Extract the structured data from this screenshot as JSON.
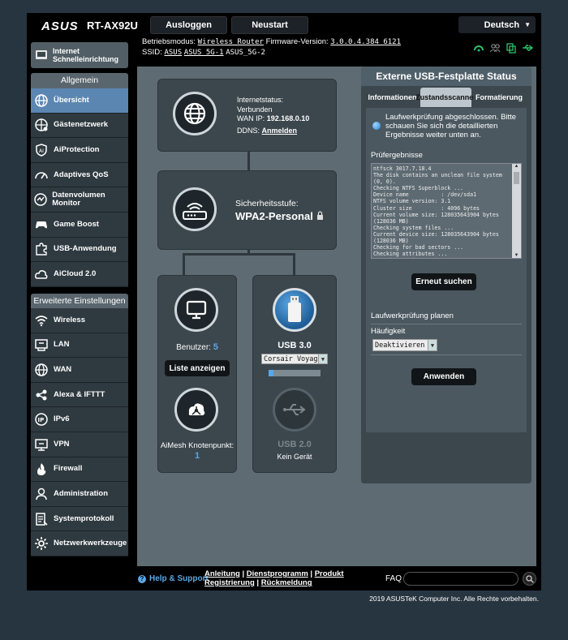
{
  "header": {
    "brand": "ASUS",
    "model": "RT-AX92U",
    "logout_label": "Ausloggen",
    "restart_label": "Neustart",
    "language": "Deutsch",
    "op_mode_label": "Betriebsmodus:",
    "op_mode_value": "Wireless Router",
    "firmware_label": "Firmware-Version:",
    "firmware_value": "3.0.0.4.384_6121",
    "ssid_label": "SSID:",
    "ssid_1": "ASUS",
    "ssid_2": "ASUS_5G-1",
    "ssid_3": "ASUS_5G-2"
  },
  "sidebar": {
    "qis_label": "Internet Schnelleinrichtung",
    "general_header": "Allgemein",
    "general_items": [
      {
        "label": "Übersicht",
        "icon": "globe-icon"
      },
      {
        "label": "Gästenetzwerk",
        "icon": "globe-network-icon"
      },
      {
        "label": "AiProtection",
        "icon": "shield-icon"
      },
      {
        "label": "Adaptives QoS",
        "icon": "speedometer-icon"
      },
      {
        "label": "Datenvolumen Monitor",
        "icon": "traffic-monitor-icon"
      },
      {
        "label": "Game Boost",
        "icon": "gamepad-icon"
      },
      {
        "label": "USB-Anwendung",
        "icon": "puzzle-icon"
      },
      {
        "label": "AiCloud 2.0",
        "icon": "cloud-icon"
      }
    ],
    "advanced_header": "Erweiterte Einstellungen",
    "advanced_items": [
      {
        "label": "Wireless",
        "icon": "wifi-icon"
      },
      {
        "label": "LAN",
        "icon": "lan-icon"
      },
      {
        "label": "WAN",
        "icon": "globe-icon"
      },
      {
        "label": "Alexa & IFTTT",
        "icon": "alexa-icon"
      },
      {
        "label": "IPv6",
        "icon": "ipv6-icon"
      },
      {
        "label": "VPN",
        "icon": "vpn-icon"
      },
      {
        "label": "Firewall",
        "icon": "firewall-icon"
      },
      {
        "label": "Administration",
        "icon": "admin-icon"
      },
      {
        "label": "Systemprotokoll",
        "icon": "log-icon"
      },
      {
        "label": "Netzwerkwerkzeuge",
        "icon": "tools-icon"
      }
    ]
  },
  "map": {
    "internet_status_label": "Internetstatus:",
    "internet_status_value": "Verbunden",
    "wan_ip_label": "WAN IP:",
    "wan_ip_value": "192.168.0.10",
    "ddns_label": "DDNS:",
    "ddns_value": "Anmelden",
    "security_label": "Sicherheitsstufe:",
    "security_value": "WPA2-Personal",
    "clients_label": "Benutzer:",
    "clients_count": "5",
    "list_button": "Liste anzeigen",
    "aimesh_label": "AiMesh Knotenpunkt:",
    "aimesh_count": "1",
    "usb30_label": "USB 3.0",
    "usb30_device": "Corsair Voyager",
    "usb20_label": "USB 2.0",
    "usb20_status": "Kein Gerät"
  },
  "usb_panel": {
    "title": "Externe USB-Festplatte Status",
    "tabs": [
      "Informationen",
      "Zustandsscanner",
      "Formatierung"
    ],
    "status_text": "Laufwerkprüfung abgeschlossen. Bitte schauen Sie sich die detaillierten Ergebnisse weiter unten an.",
    "results_label": "Prüfergebnisse",
    "log": "ntfsck 3017.7.18.4\nThe disk contains an unclean file system\n(0, 0).\nChecking NTFS Superblock ...\nDevice name          : /dev/sda1\nNTFS volume version: 3.1\nCluster size         : 4096 bytes\nCurrent volume size: 128035643904 bytes\n(128036 MB)\nChecking system files ...\nCurrent device size: 128035643904 bytes\n(128036 MB)\nChecking for bad sectors ...\nChecking attributes ...\nNTFS is consistent.",
    "rescan_button": "Erneut suchen",
    "schedule_label": "Laufwerkprüfung planen",
    "frequency_label": "Häufigkeit",
    "frequency_value": "Deaktivieren",
    "apply_button": "Anwenden"
  },
  "footer": {
    "help_label": "Help & Support",
    "link_manual": "Anleitung",
    "link_utility": "Dienstprogramm",
    "link_product": "Produkt",
    "link_register": "Registrierung",
    "link_feedback": "Rückmeldung",
    "faq_label": "FAQ",
    "copyright": "2019 ASUSTeK Computer Inc. Alle Rechte vorbehalten."
  },
  "colors": {
    "active_menu": "#5c86b2",
    "accent_blue": "#5aa7e6",
    "status_green": "#29c36a"
  }
}
